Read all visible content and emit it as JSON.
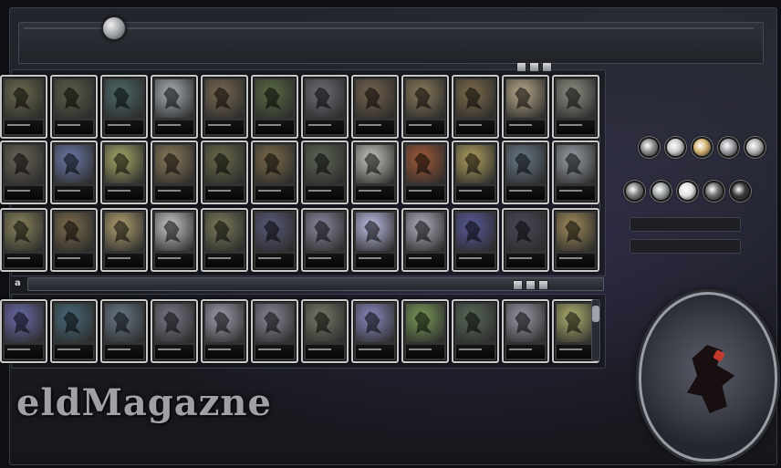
{
  "header": {
    "top_right_small_text": ""
  },
  "sections": [
    {
      "row_label": ""
    },
    {
      "row_label": "a"
    }
  ],
  "collection_rows": [
    {
      "cards": [
        {
          "art": "#6b6a4d"
        },
        {
          "art": "#5b5f4a"
        },
        {
          "art": "#4d6a6a"
        },
        {
          "art": "#a9b0b5"
        },
        {
          "art": "#7a6a52"
        },
        {
          "art": "#5a6b44"
        },
        {
          "art": "#6f7078"
        },
        {
          "art": "#76644e"
        },
        {
          "art": "#8a7a5a"
        },
        {
          "art": "#7e6b4a"
        },
        {
          "art": "#b8a98a"
        },
        {
          "art": "#8c8f83"
        }
      ]
    },
    {
      "cards": [
        {
          "art": "#6a6458"
        },
        {
          "art": "#6c7aa8"
        },
        {
          "art": "#a8a86a"
        },
        {
          "art": "#8c7a5a"
        },
        {
          "art": "#6a6a4a"
        },
        {
          "art": "#7a6a4a"
        },
        {
          "art": "#5e6656"
        },
        {
          "art": "#c8c8c0"
        },
        {
          "art": "#a05a3a"
        },
        {
          "art": "#b0a060"
        },
        {
          "art": "#6a7a8a"
        },
        {
          "art": "#9aa0a8"
        }
      ]
    },
    {
      "cards": [
        {
          "art": "#8a845a"
        },
        {
          "art": "#7a6a4a"
        },
        {
          "art": "#b0a070"
        },
        {
          "art": "#c8c8c8"
        },
        {
          "art": "#7a7a5a"
        },
        {
          "art": "#5a5a7a"
        },
        {
          "art": "#8a8aa0"
        },
        {
          "art": "#c0c0e8"
        },
        {
          "art": "#b0b0c0"
        },
        {
          "art": "#5a5a9a"
        },
        {
          "art": "#4a4a5a"
        },
        {
          "art": "#a08a5a"
        }
      ]
    }
  ],
  "deck_row": {
    "cards": [
      {
        "art": "#6a6aaa"
      },
      {
        "art": "#4a6a7a"
      },
      {
        "art": "#6a7a8a"
      },
      {
        "art": "#7a7a8a"
      },
      {
        "art": "#a0a0b0"
      },
      {
        "art": "#8a8a9a"
      },
      {
        "art": "#7a7a6a"
      },
      {
        "art": "#8a8ac0"
      },
      {
        "art": "#7a9a5a"
      },
      {
        "art": "#5a6a5a"
      },
      {
        "art": "#9a9aa8"
      },
      {
        "art": "#b0b070"
      }
    ]
  },
  "filters": {
    "row1": [
      "#8a8a8a",
      "#c8c8c8",
      "#d0b070",
      "#9a9aa0",
      "#b0b0b0"
    ],
    "row2": [
      "#7a7a7a",
      "#9aa0a0",
      "#e0e0e0",
      "#6a6a6a",
      "#3a3a3a"
    ]
  },
  "watermark": "eldMagazne"
}
